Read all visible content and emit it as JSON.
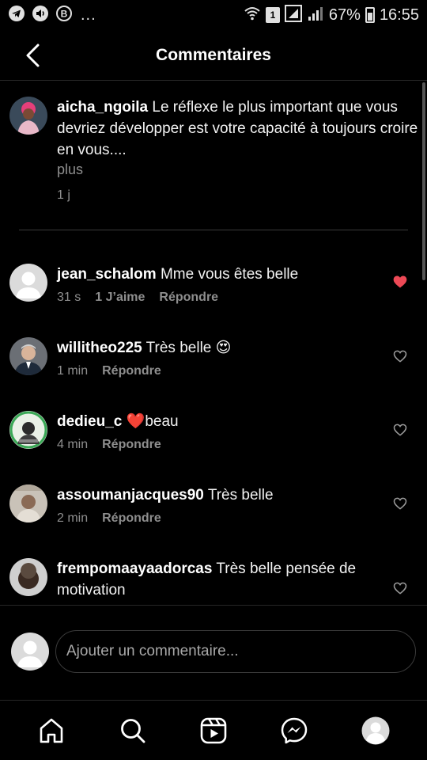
{
  "status_bar": {
    "dots": "...",
    "sim_badge": "1",
    "battery": "67%",
    "time": "16:55"
  },
  "header": {
    "title": "Commentaires"
  },
  "post_caption": {
    "username": "aicha_ngoila",
    "text": "Le réflexe le plus important que vous devriez développer est votre capacité à toujours croire en vous....",
    "more_label": "plus",
    "time": "1 j"
  },
  "comments": [
    {
      "username": "jean_schalom",
      "text": "Mme vous êtes belle",
      "time": "31 s",
      "likes": "1 J’aime",
      "reply": "Répondre",
      "liked": true
    },
    {
      "username": "willitheo225",
      "text": "Très belle 😍",
      "time": "1 min",
      "reply": "Répondre",
      "liked": false
    },
    {
      "username": "dedieu_c",
      "text": "❤️beau",
      "time": "4 min",
      "reply": "Répondre",
      "liked": false
    },
    {
      "username": "assoumanjacques90",
      "text": "Très belle",
      "time": "2 min",
      "reply": "Répondre",
      "liked": false
    },
    {
      "username": "frempomaayaadorcas",
      "text": "Très belle pensée de motivation",
      "liked": false
    }
  ],
  "add_comment": {
    "placeholder": "Ajouter un commentaire..."
  },
  "bottom_nav": {
    "items": [
      "home-icon",
      "search-icon",
      "reels-icon",
      "messenger-icon",
      "profile-icon"
    ]
  },
  "colors": {
    "background": "#000000",
    "like_red": "#ed4956",
    "muted": "#8e8e8e"
  }
}
